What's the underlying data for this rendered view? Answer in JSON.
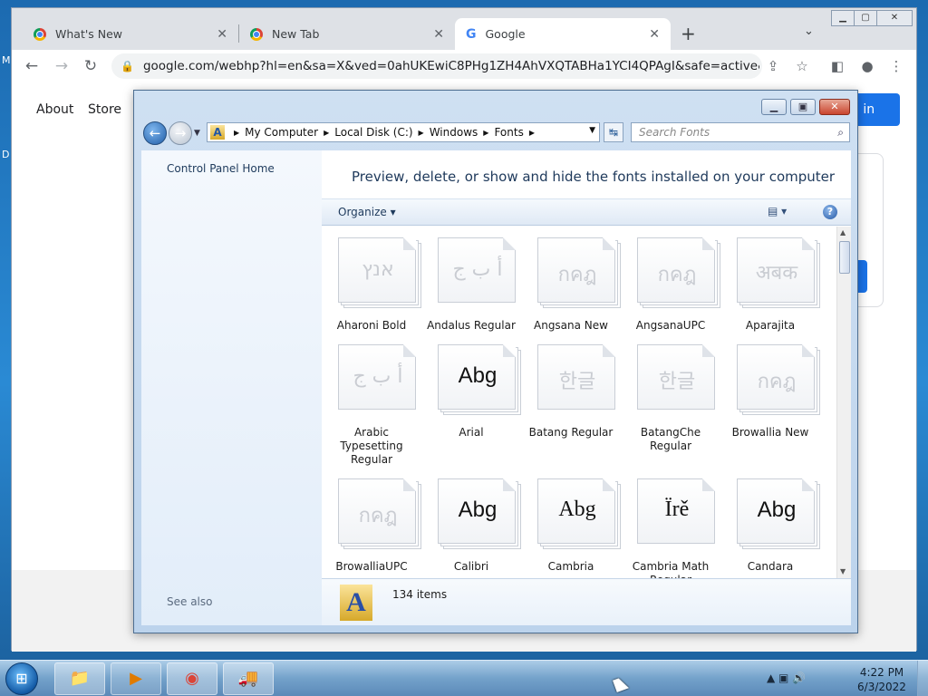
{
  "browser": {
    "tabs": [
      {
        "title": "What's New",
        "icon": "chrome-icon",
        "close": "✕"
      },
      {
        "title": "New Tab",
        "icon": "chrome-icon",
        "close": "✕"
      },
      {
        "title": "Google",
        "icon": "google-icon",
        "close": "✕"
      }
    ],
    "new_tab": "+",
    "tab_list": "⌄",
    "window_controls": {
      "minimize": "▁",
      "maximize": "▢",
      "close": "✕"
    },
    "nav": {
      "back": "←",
      "forward": "→",
      "reload": "↻"
    },
    "url": "google.com/webhp?hl=en&sa=X&ved=0ahUKEwiC8PHg1ZH4AhVXQTABHa1YCI4QPAgI&safe=active&ssui...",
    "lock": "🔒",
    "toolbar_icons": {
      "share": "⇪",
      "bookmark": "☆",
      "sidepanel": "◧",
      "profile": "●",
      "menu": "⋮"
    }
  },
  "google_page": {
    "links": {
      "about": "About",
      "store": "Store"
    },
    "signin_partial": "n in"
  },
  "explorer": {
    "window_buttons": {
      "minimize": "▁",
      "maximize": "▣",
      "close": "✕"
    },
    "nav": {
      "back": "←",
      "forward": "→",
      "dropdown": "▼"
    },
    "breadcrumbs": [
      "My Computer",
      "Local Disk (C:)",
      "Windows",
      "Fonts"
    ],
    "crumb_sep": "▶",
    "addr_dropdown": "▼",
    "refresh": "↹",
    "search_placeholder": "Search Fonts",
    "search_icon": "⌕",
    "control_panel_home": "Control Panel Home",
    "see_also": "See also",
    "headline": "Preview, delete, or show and hide the fonts installed on your computer",
    "organize": "Organize ▾",
    "views_icon": "▤ ▾",
    "help": "?",
    "fonts": [
      {
        "name": "Aharoni Bold",
        "glyph": "אנץ",
        "style": "faint",
        "stack": true
      },
      {
        "name": "Andalus Regular",
        "glyph": "أ ب ج",
        "style": "faint",
        "stack": false
      },
      {
        "name": "Angsana New",
        "glyph": "กคฎ",
        "style": "faint",
        "stack": true
      },
      {
        "name": "AngsanaUPC",
        "glyph": "กคฎ",
        "style": "faint",
        "stack": true
      },
      {
        "name": "Aparajita",
        "glyph": "अबक",
        "style": "faint",
        "stack": true
      },
      {
        "name": "Arabic Typesetting Regular",
        "glyph": "أ ب ج",
        "style": "faint",
        "stack": false
      },
      {
        "name": "Arial",
        "glyph": "Abg",
        "style": "dark",
        "stack": true
      },
      {
        "name": "Batang Regular",
        "glyph": "한글",
        "style": "faint",
        "stack": false
      },
      {
        "name": "BatangChe Regular",
        "glyph": "한글",
        "style": "faint",
        "stack": false
      },
      {
        "name": "Browallia New",
        "glyph": "กคฎ",
        "style": "faint",
        "stack": true
      },
      {
        "name": "BrowalliaUPC",
        "glyph": "กคฎ",
        "style": "faint",
        "stack": true
      },
      {
        "name": "Calibri",
        "glyph": "Abg",
        "style": "dark",
        "stack": true
      },
      {
        "name": "Cambria",
        "glyph": "Abg",
        "style": "dark-serif",
        "stack": true
      },
      {
        "name": "Cambria Math Regular",
        "glyph": "Ïrě",
        "style": "dark-serif",
        "stack": false
      },
      {
        "name": "Candara",
        "glyph": "Abg",
        "style": "dark",
        "stack": true
      }
    ],
    "scroll": {
      "up": "▲",
      "down": "▼"
    },
    "detail_icon": "A",
    "items_count": "134 items"
  },
  "taskbar": {
    "start": "⊞",
    "apps": [
      {
        "name": "explorer",
        "glyph": "📁"
      },
      {
        "name": "media",
        "glyph": "▶"
      },
      {
        "name": "chrome",
        "glyph": "◉"
      },
      {
        "name": "app",
        "glyph": "🚚"
      }
    ],
    "tray": "▲  ▣  🔊",
    "time": "4:22 PM",
    "date": "6/3/2022"
  },
  "desktop": {
    "edge_letters": [
      "M",
      "D"
    ]
  }
}
